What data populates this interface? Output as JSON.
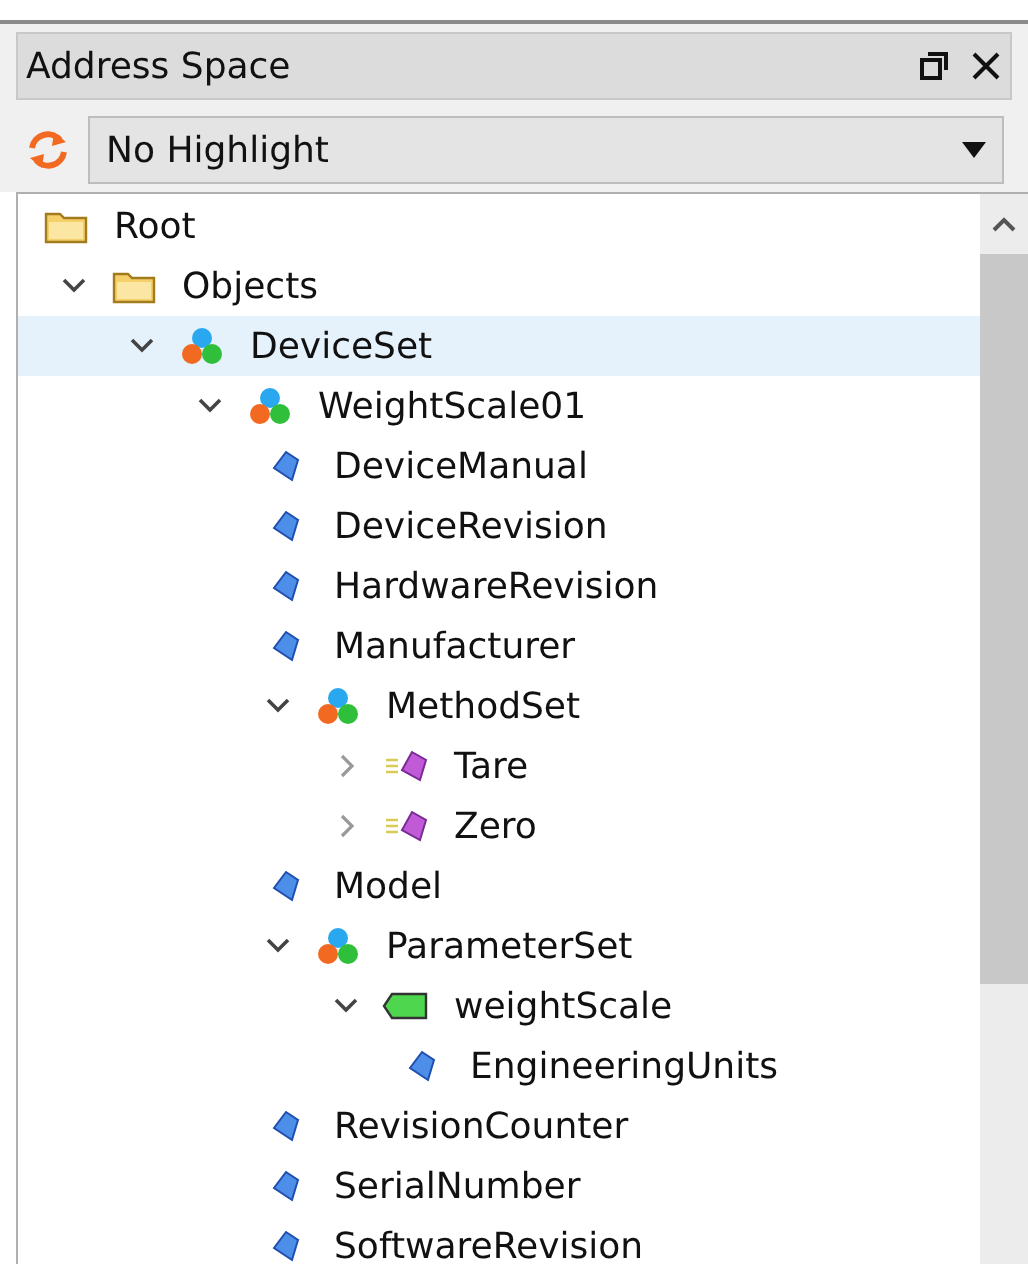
{
  "panel": {
    "title": "Address Space"
  },
  "toolbar": {
    "highlight_select": {
      "value": "No Highlight"
    }
  },
  "tree": [
    {
      "label": "Root",
      "kind": "folder",
      "selected": false,
      "children": [
        {
          "label": "Objects",
          "kind": "folder",
          "selected": false,
          "expanded": true,
          "children": [
            {
              "label": "DeviceSet",
              "kind": "object",
              "selected": true,
              "expanded": true,
              "children": [
                {
                  "label": "WeightScale01",
                  "kind": "object",
                  "selected": false,
                  "expanded": true,
                  "children": [
                    {
                      "label": "DeviceManual",
                      "kind": "variable",
                      "selected": false
                    },
                    {
                      "label": "DeviceRevision",
                      "kind": "variable",
                      "selected": false
                    },
                    {
                      "label": "HardwareRevision",
                      "kind": "variable",
                      "selected": false
                    },
                    {
                      "label": "Manufacturer",
                      "kind": "variable",
                      "selected": false
                    },
                    {
                      "label": "MethodSet",
                      "kind": "object",
                      "selected": false,
                      "expanded": true,
                      "children": [
                        {
                          "label": "Tare",
                          "kind": "method",
                          "selected": false,
                          "expanded": false
                        },
                        {
                          "label": "Zero",
                          "kind": "method",
                          "selected": false,
                          "expanded": false
                        }
                      ]
                    },
                    {
                      "label": "Model",
                      "kind": "variable",
                      "selected": false
                    },
                    {
                      "label": "ParameterSet",
                      "kind": "object",
                      "selected": false,
                      "expanded": true,
                      "children": [
                        {
                          "label": "weightScale",
                          "kind": "tag",
                          "selected": false,
                          "expanded": true,
                          "children": [
                            {
                              "label": "EngineeringUnits",
                              "kind": "variable",
                              "selected": false
                            }
                          ]
                        }
                      ]
                    },
                    {
                      "label": "RevisionCounter",
                      "kind": "variable",
                      "selected": false
                    },
                    {
                      "label": "SerialNumber",
                      "kind": "variable",
                      "selected": false
                    },
                    {
                      "label": "SoftwareRevision",
                      "kind": "variable",
                      "selected": false
                    }
                  ]
                }
              ]
            }
          ]
        }
      ]
    }
  ]
}
